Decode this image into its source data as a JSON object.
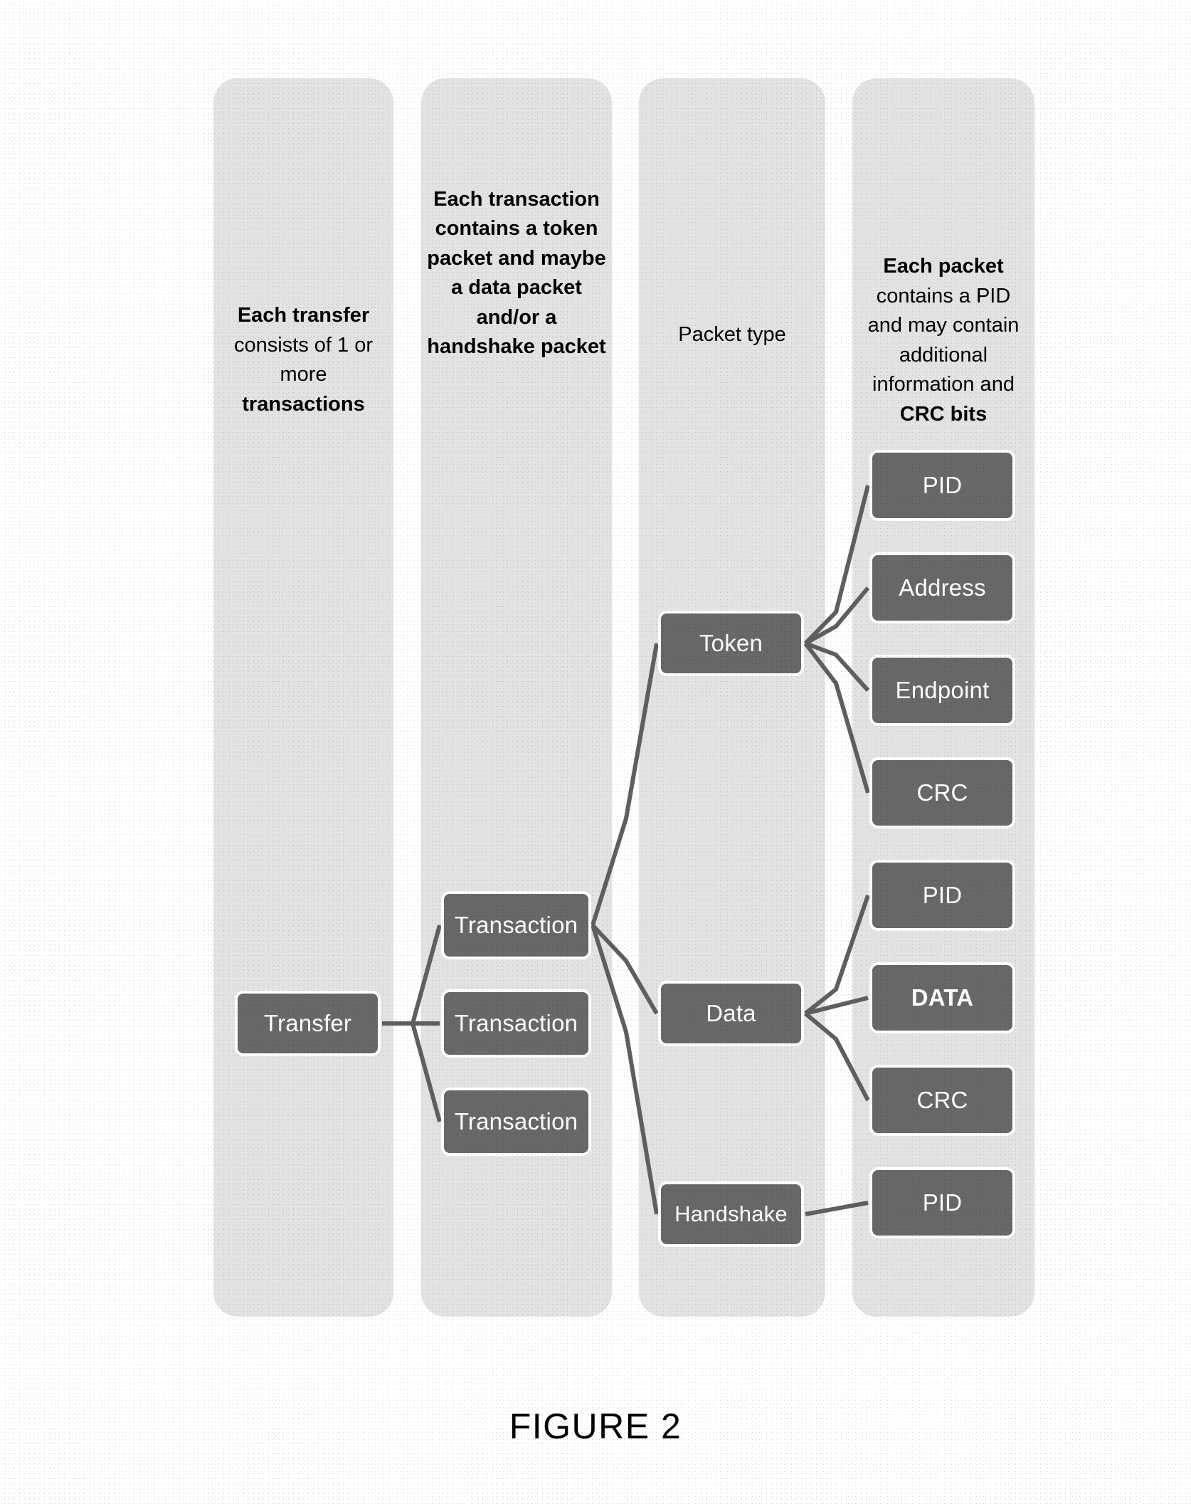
{
  "figure": {
    "caption": "FIGURE 2"
  },
  "columns": [
    {
      "id": "transfer",
      "header_lead": "Each transfer",
      "header_mid": " consists of 1 or more ",
      "header_tail": "transactions",
      "header_plain": "Each transfer consists of 1 or more transactions"
    },
    {
      "id": "transaction",
      "header_plain": "Each transaction contains a token packet and maybe a data packet and/or a handshake packet"
    },
    {
      "id": "packet_type",
      "header_plain": "Packet type"
    },
    {
      "id": "packet_parts",
      "header_lead": "Each packet",
      "header_mid": " contains a PID and may contain additional information and ",
      "header_tail": "CRC bits",
      "header_plain": "Each packet contains a PID and may contain additional information and CRC bits"
    }
  ],
  "nodes": {
    "transfer": "Transfer",
    "transactions": [
      "Transaction",
      "Transaction",
      "Transaction"
    ],
    "packet_types": [
      "Token",
      "Data",
      "Handshake"
    ],
    "packet_parts": [
      "PID",
      "Address",
      "Endpoint",
      "CRC",
      "PID",
      "DATA",
      "CRC",
      "PID"
    ]
  },
  "colors": {
    "column_background": "#e3e3e3",
    "node_fill": "#686868",
    "node_text": "#ffffff",
    "connector": "#5f5f5f",
    "page_background": "#ffffff",
    "caption_text": "#000000"
  }
}
